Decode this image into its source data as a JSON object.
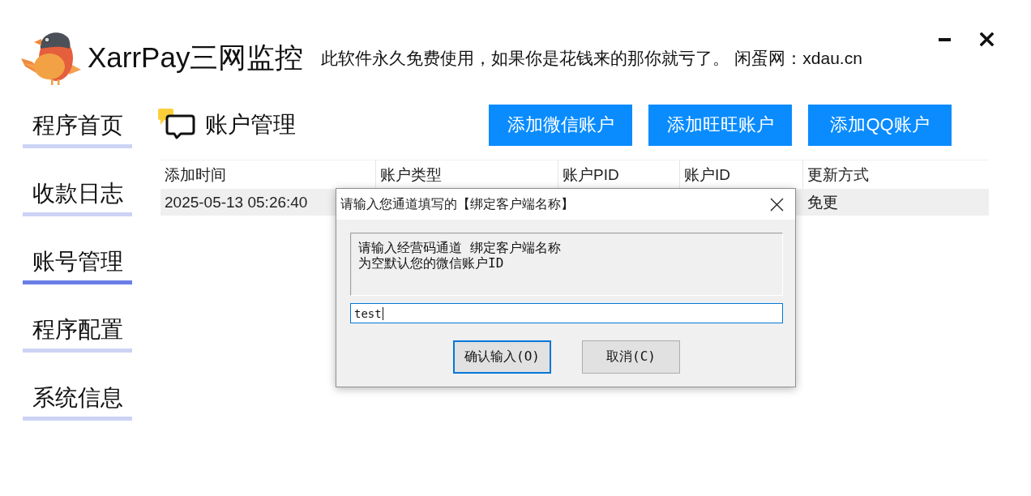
{
  "window": {
    "title": "XarrPay三网监控",
    "notice": "此软件永久免费使用，如果你是花钱来的那你就亏了。 闲蛋网：xdau.cn"
  },
  "sidebar": {
    "items": [
      {
        "label": "程序首页",
        "selected": false
      },
      {
        "label": "收款日志",
        "selected": false
      },
      {
        "label": "账号管理",
        "selected": true
      },
      {
        "label": "程序配置",
        "selected": false
      },
      {
        "label": "系统信息",
        "selected": false
      }
    ]
  },
  "page": {
    "title": "账户管理",
    "actions": [
      "添加微信账户",
      "添加旺旺账户",
      "添加QQ账户"
    ]
  },
  "table": {
    "columns": [
      "添加时间",
      "账户类型",
      "账户PID",
      "账户ID",
      "更新方式"
    ],
    "rows": [
      {
        "added_time": "2025-05-13 05:26:40",
        "update_method": "免更",
        "selected": true
      }
    ]
  },
  "dialog": {
    "title": "请输入您通道填写的【绑定客户端名称】",
    "message": [
      "请输入经营码通道 绑定客户端名称",
      "为空默认您的微信账户ID"
    ],
    "input": {
      "value": "test",
      "focused": true
    },
    "buttons": [
      {
        "label": "确认输入(O)",
        "default": true
      },
      {
        "label": "取消(C)",
        "default": false
      }
    ]
  }
}
